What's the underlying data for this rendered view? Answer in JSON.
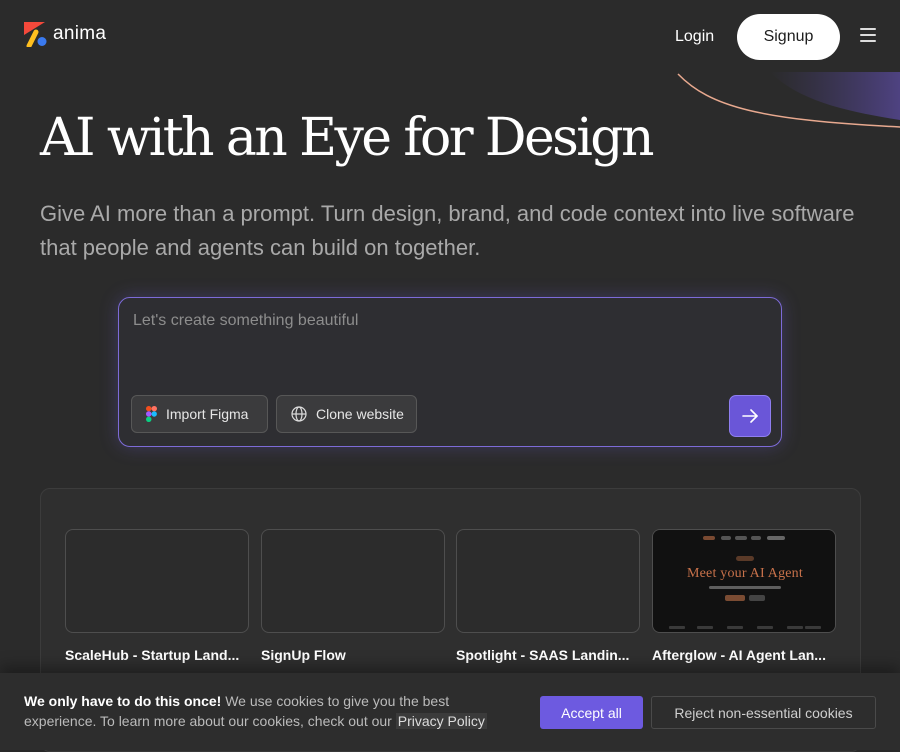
{
  "header": {
    "logo_text": "anima",
    "login_label": "Login",
    "signup_label": "Signup"
  },
  "hero": {
    "title": "AI with an Eye for Design",
    "subtitle": "Give AI more than a prompt. Turn design, brand, and code context into live software that people and agents can build on together."
  },
  "prompt": {
    "placeholder": "Let's create something beautiful",
    "value": "",
    "import_figma_label": "Import Figma",
    "clone_website_label": "Clone website"
  },
  "templates": [
    {
      "title": "ScaleHub - Startup Land..."
    },
    {
      "title": "SignUp Flow"
    },
    {
      "title": "Spotlight - SAAS Landin..."
    },
    {
      "title": "Afterglow - AI Agent Lan...",
      "preview_heading": "Meet your AI Agent"
    }
  ],
  "cookie": {
    "bold": "We only have to do this once!",
    "text": " We use cookies to give you the best experience. To learn more about our cookies, check out our ",
    "privacy_link": "Privacy Policy",
    "accept_label": "Accept all",
    "reject_label": "Reject non-essential cookies"
  },
  "colors": {
    "background": "#2b2b2b",
    "accent": "#6d5ae0",
    "logo_red": "#f4493b",
    "logo_yellow": "#ffbf1f",
    "logo_blue": "#3a7af0",
    "deco_line": "#e8a98f"
  },
  "icons": [
    "anima-logo-icon",
    "menu-icon",
    "figma-icon",
    "globe-icon",
    "arrow-right-icon"
  ]
}
